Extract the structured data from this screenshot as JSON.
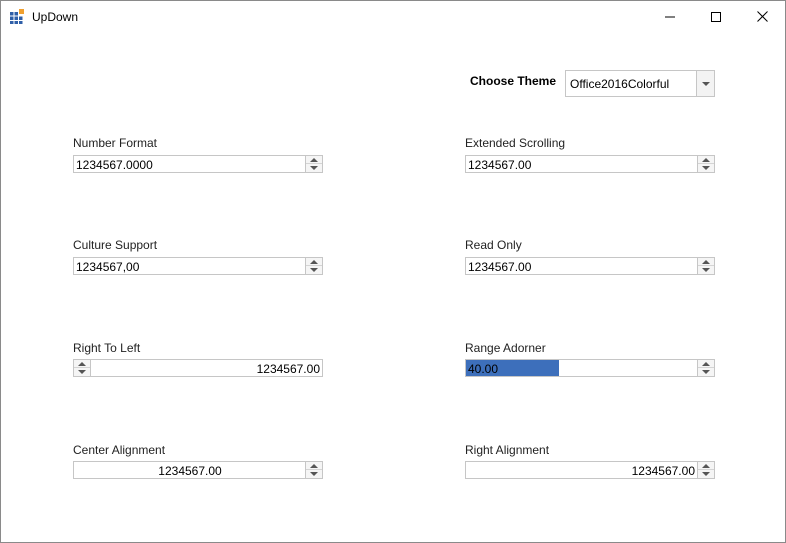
{
  "window": {
    "title": "UpDown",
    "icon": "app-grid-icon",
    "controls": {
      "minimize": "minimize-icon",
      "maximize": "maximize-icon",
      "close": "close-icon"
    }
  },
  "theme": {
    "label": "Choose Theme",
    "selected": "Office2016Colorful"
  },
  "fields": {
    "number_format": {
      "label": "Number Format",
      "value": "1234567.0000"
    },
    "extended_scrolling": {
      "label": "Extended Scrolling",
      "value": "1234567.00"
    },
    "culture_support": {
      "label": "Culture Support",
      "value": "1234567,00"
    },
    "read_only": {
      "label": "Read Only",
      "value": "1234567.00"
    },
    "right_to_left": {
      "label": "Right To Left",
      "value": "1234567.00"
    },
    "range_adorner": {
      "label": "Range Adorner",
      "value": "40.00",
      "fill_fraction": 0.4,
      "fill_color": "#3d6fbb"
    },
    "center_alignment": {
      "label": "Center Alignment",
      "value": "1234567.00"
    },
    "right_alignment": {
      "label": "Right Alignment",
      "value": "1234567.00"
    }
  },
  "colors": {
    "border": "#c6c6c6",
    "spin_bg": "#f5f5f5",
    "app_icon_blue": "#2f5fa8",
    "app_icon_orange": "#f0a030"
  }
}
